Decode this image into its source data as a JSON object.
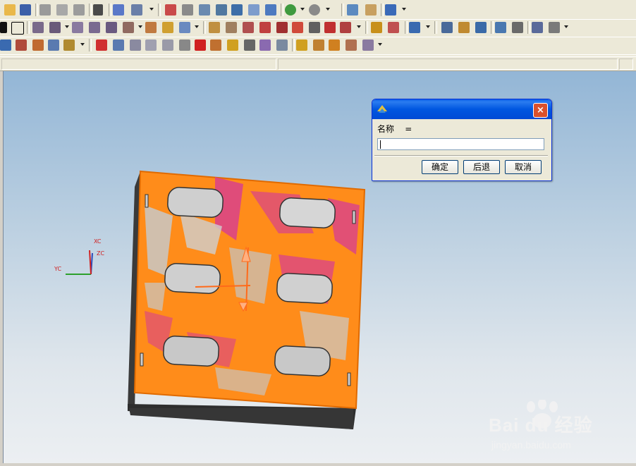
{
  "dialog": {
    "name_label": "名称    =",
    "input_value": "",
    "ok_label": "确定",
    "back_label": "后退",
    "cancel_label": "取消",
    "close_glyph": "×"
  },
  "axes": {
    "xc": "XC",
    "yc": "YC",
    "zc": "ZC"
  },
  "watermark": {
    "brand": "Bai du 经验",
    "url": "jingyan.baidu.com"
  },
  "colors": {
    "part_face": "#ff8c1a",
    "part_side": "#333333",
    "highlight": "#d9418c",
    "dialog_title": "#0054e3"
  }
}
